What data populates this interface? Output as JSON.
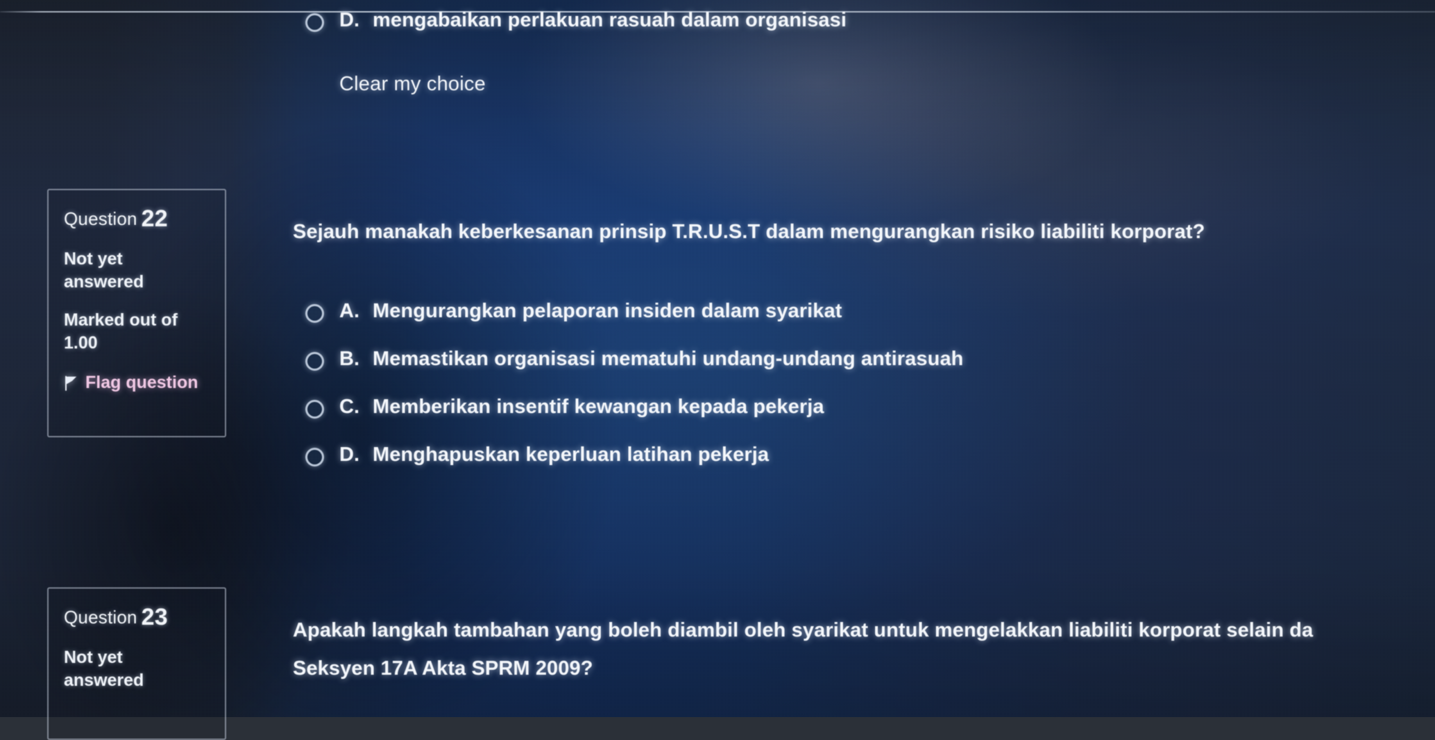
{
  "page": {
    "platform": "moodle-quiz-attempt",
    "language": "ms"
  },
  "colors": {
    "screen_blue": "#2d5582",
    "screen_gray": "#3c414b",
    "text_primary": "#f4f7fb",
    "flag_pink": "#f0c8e4",
    "box_border": "rgba(205,214,228,0.55)"
  },
  "previous_question_tail": {
    "option": {
      "letter": "D.",
      "text": "mengabaikan perlakuan rasuah dalam organisasi",
      "radio_state": "unselected"
    },
    "clear_choice_label": "Clear my choice"
  },
  "questions": [
    {
      "id": "q22",
      "info": {
        "label": "Question",
        "number": "22",
        "state": "Not yet answered",
        "grade_label": "Marked out of",
        "grade_value": "1.00",
        "flag_label": "Flag question",
        "flag_icon": "flag-icon",
        "flagged": false
      },
      "stem": "Sejauh manakah keberkesanan prinsip T.R.U.S.T dalam mengurangkan risiko liabiliti korporat?",
      "options": [
        {
          "letter": "A.",
          "text": "Mengurangkan pelaporan insiden dalam syarikat",
          "radio_state": "unselected"
        },
        {
          "letter": "B.",
          "text": "Memastikan organisasi mematuhi undang-undang antirasuah",
          "radio_state": "unselected"
        },
        {
          "letter": "C.",
          "text": "Memberikan insentif kewangan kepada pekerja",
          "radio_state": "unselected"
        },
        {
          "letter": "D.",
          "text": "Menghapuskan keperluan latihan pekerja",
          "radio_state": "unselected"
        }
      ]
    },
    {
      "id": "q23",
      "info": {
        "label": "Question",
        "number": "23",
        "state": "Not yet answered"
      },
      "stem_line_1": "Apakah langkah tambahan yang boleh diambil oleh syarikat untuk mengelakkan liabiliti korporat selain da",
      "stem_line_2": "Seksyen 17A Akta SPRM 2009?"
    }
  ]
}
